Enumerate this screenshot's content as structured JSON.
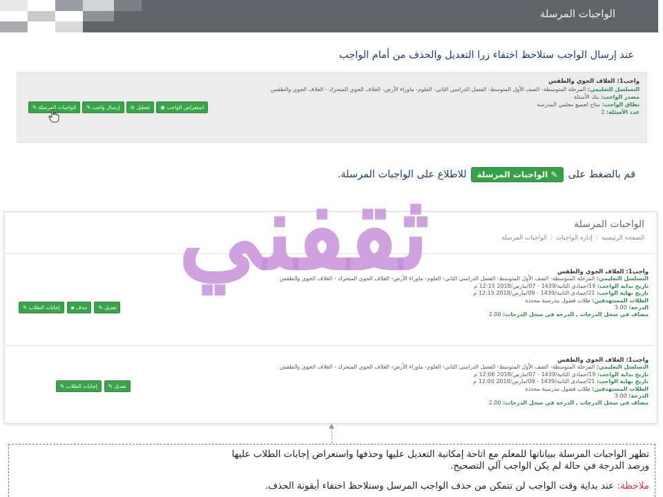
{
  "banner": {
    "title": "الواجبات المرسلة"
  },
  "intro": "عند إرسال الواجب ستلاحظ اختفاء زرا التعديل والحذف من أمام الواجب",
  "panel1": {
    "title": "واجب1: الغلاف الجوي والطقس",
    "rows": [
      {
        "label": "التسلسل التعليمي:",
        "value": "المرحلة المتوسطة- الصف الأول المتوسط- الفصل الدراسي الثاني- العلوم- ماوراء الأرض- الغلاف الجوي المتحرك - الغلاف الجوي والطقس"
      },
      {
        "label": "مصدر الواجب:",
        "value": "بنك الأسئلة"
      },
      {
        "label": "نطاق الواجب:",
        "value": "متاح لجميع معلمي المدرسة"
      },
      {
        "label": "عدد الأسئلة:",
        "value": "2"
      }
    ],
    "buttons": [
      "استعراض الواجب",
      "تعطيل",
      "إرسال واجب",
      "الواجبات المرسلة"
    ]
  },
  "instruction": {
    "before": "قم بالضغط على",
    "button": "الواجبات المرسلة",
    "after": "للاطلاع على الواجبات المرسلة."
  },
  "panel2": {
    "title": "الواجبات المرسلة",
    "breadcrumb": [
      "الصفحة الرئيسية",
      "إدارة الواجبات",
      "الواجبات المرسلة"
    ],
    "cards": [
      {
        "title": "واجب1: الغلاف الجوي والطقس",
        "sequence_label": "التسلسل التعليمي:",
        "sequence": "المرحلة المتوسطة- الصف الأول المتوسط- الفصل الدراسي الثاني- العلوم- ماوراء الأرض- الغلاف الجوي المتحرك - الغلاف الجوي والطقس",
        "start_label": "تاريخ بداية الواجب:",
        "start": "19/جمادى الثانية/1439 - 07/مارس/2018 12:15 م",
        "end_label": "تاريخ نهاية الواجب:",
        "end": "21/جمادى الثانية/1439 - 09/مارس/2018 12:15 م",
        "students_label": "الطلاب المستهدفين:",
        "students": "طلاب فصول مدرسية محددة",
        "grade_label": "الدرجة:",
        "grade": "3.00",
        "gradebook_label": "مضاف في سجل الدرجات , الدرجة في سجل الدرجات:",
        "gradebook": "2.00",
        "buttons": [
          "تعديل",
          "حذف",
          "إجابات الطلاب"
        ]
      },
      {
        "title": "واجب1: الغلاف الجوي والطقس",
        "sequence_label": "التسلسل التعليمي:",
        "sequence": "المرحلة المتوسطة- الصف الأول المتوسط- الفصل الدراسي الثاني- العلوم- ماوراء الأرض- الغلاف الجوي المتحرك - الغلاف الجوي والطقس",
        "start_label": "تاريخ بداية الواجب:",
        "start": "19/جمادى الثانية/1439 - 07/مارس/2018 12:06 م",
        "end_label": "تاريخ نهاية الواجب:",
        "end": "21/جمادى الثانية/1439 - 09/مارس/2018 12:00 م",
        "students_label": "الطلاب المستهدفين:",
        "students": "طلاب فصول مدرسية محددة",
        "grade_label": "الدرجة:",
        "grade": "3.00",
        "gradebook_label": "مضاف في سجل الدرجات , الدرجة في سجل الدرجات:",
        "gradebook": "2.00",
        "buttons": [
          "تعديل",
          "إجابات الطلاب"
        ]
      }
    ]
  },
  "watermark": "ثقفني",
  "note": {
    "line1": "تظهر الواجبات المرسلة ببياناتها للمعلم مع اتاحة إمكانية التعديل عليها وحذفها واستعراض إجابات الطلاب عليها",
    "line2": "ورصد الدرجة في حالة لم يكن الواجب آلي التصحيح.",
    "remark_label": "ملاحظة:",
    "remark": "عند بداية وقت الواجب لن تتمكن من حذف الواجب المرسل وستلاحظ اختفاء أيقونة الحذف."
  },
  "colors": {
    "banner": "#606469",
    "accent_green": "#3aa44a",
    "label_green": "#2e8b57",
    "watermark": "#c48dd8",
    "remark_red": "#e0303a"
  },
  "icons": {
    "eye": "eye-icon",
    "minus-circle": "minus-circle-icon",
    "edit": "edit-icon",
    "trash": "trash-icon",
    "pointer": "hand-pointer-icon"
  }
}
